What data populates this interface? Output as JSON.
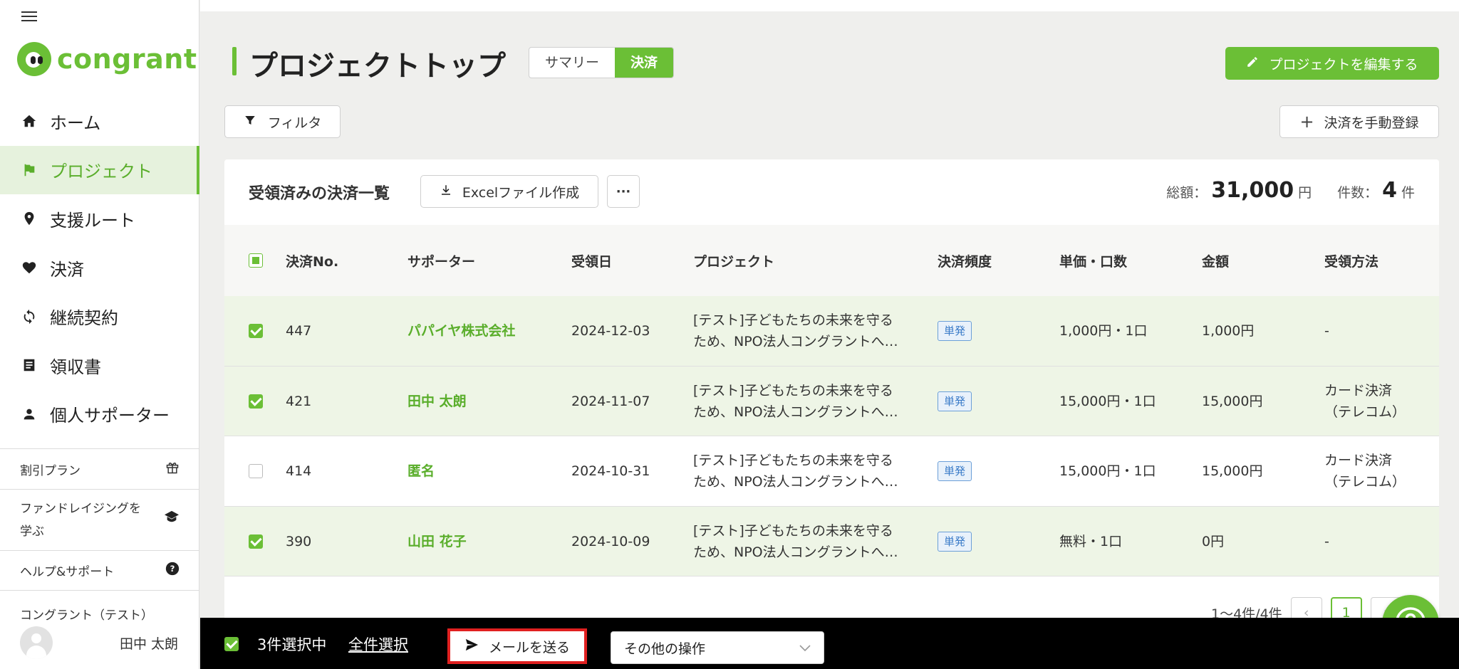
{
  "app": {
    "logo_text": "congrant",
    "brand_color": "#6bbf36"
  },
  "sidebar": {
    "items": [
      {
        "label": "ホーム",
        "icon": "home-icon",
        "active": false
      },
      {
        "label": "プロジェクト",
        "icon": "flag-icon",
        "active": true
      },
      {
        "label": "支援ルート",
        "icon": "map-pin-icon",
        "active": false
      },
      {
        "label": "決済",
        "icon": "heart-icon",
        "active": false
      },
      {
        "label": "継続契約",
        "icon": "refresh-icon",
        "active": false
      },
      {
        "label": "領収書",
        "icon": "receipt-icon",
        "active": false
      },
      {
        "label": "個人サポーター",
        "icon": "person-icon",
        "active": false
      }
    ],
    "sub_items": [
      {
        "label": "割引プラン",
        "icon": "gift-box-icon"
      },
      {
        "label": "ファンドレイジングを学ぶ",
        "icon": "graduation-cap-icon"
      },
      {
        "label": "ヘルプ&サポート",
        "icon": "question-circle-icon"
      }
    ],
    "org_name": "コングラント（テスト）",
    "user_name": "田中 太朗"
  },
  "header": {
    "title": "プロジェクトトップ",
    "tabs": [
      {
        "label": "サマリー",
        "active": false
      },
      {
        "label": "決済",
        "active": true
      }
    ],
    "edit_button": "プロジェクトを編集する",
    "filter_button": "フィルタ",
    "manual_register_button": "決済を手動登録"
  },
  "panel": {
    "title": "受領済みの決済一覧",
    "excel_button": "Excelファイル作成",
    "more_button": "···",
    "total_label": "総額：",
    "total_value": "31,000",
    "total_unit": "円",
    "count_label": "件数：",
    "count_value": "4",
    "count_unit": "件"
  },
  "table": {
    "columns": [
      "決済No.",
      "サポーター",
      "受領日",
      "プロジェクト",
      "決済頻度",
      "単価・口数",
      "金額",
      "受領方法"
    ],
    "rows": [
      {
        "selected": true,
        "no": "447",
        "supporter": "パパイヤ株式会社",
        "date": "2024-12-03",
        "project_line1": "[テスト]子どもたちの未来を守る",
        "project_line2": "ため、NPO法人コングラントへ…",
        "frequency": "単発",
        "unit": "1,000円・1口",
        "amount": "1,000円",
        "method_line1": "-",
        "method_line2": ""
      },
      {
        "selected": true,
        "no": "421",
        "supporter": "田中 太朗",
        "date": "2024-11-07",
        "project_line1": "[テスト]子どもたちの未来を守る",
        "project_line2": "ため、NPO法人コングラントへ…",
        "frequency": "単発",
        "unit": "15,000円・1口",
        "amount": "15,000円",
        "method_line1": "カード決済",
        "method_line2": "（テレコム）"
      },
      {
        "selected": false,
        "no": "414",
        "supporter": "匿名",
        "date": "2024-10-31",
        "project_line1": "[テスト]子どもたちの未来を守る",
        "project_line2": "ため、NPO法人コングラントへ…",
        "frequency": "単発",
        "unit": "15,000円・1口",
        "amount": "15,000円",
        "method_line1": "カード決済",
        "method_line2": "（テレコム）"
      },
      {
        "selected": true,
        "no": "390",
        "supporter": "山田 花子",
        "date": "2024-10-09",
        "project_line1": "[テスト]子どもたちの未来を守る",
        "project_line2": "ため、NPO法人コングラントへ…",
        "frequency": "単発",
        "unit": "無料・1口",
        "amount": "0円",
        "method_line1": "-",
        "method_line2": ""
      }
    ]
  },
  "pagination": {
    "summary": "1〜4件/4件",
    "current": "1",
    "prev": "‹",
    "next": "›"
  },
  "bottom_bar": {
    "selected_count": "3件選択中",
    "select_all": "全件選択",
    "send_mail": "メールを送る",
    "other_actions": "その他の操作"
  }
}
